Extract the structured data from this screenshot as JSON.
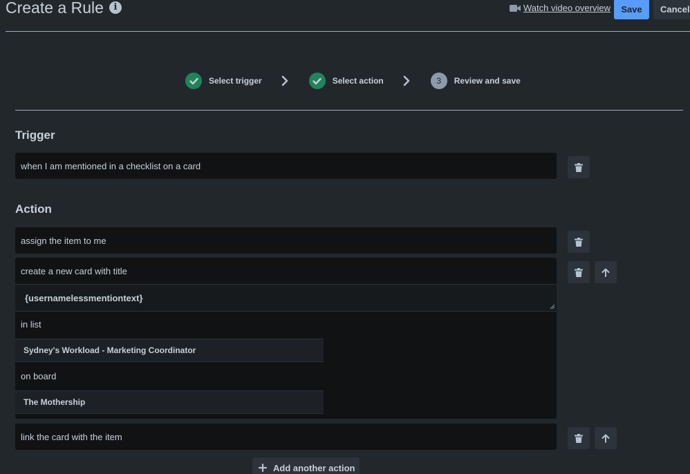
{
  "header": {
    "title": "Create a Rule",
    "watch_video": "Watch video overview",
    "save_label": "Save",
    "cancel_label": "Cancel"
  },
  "stepper": {
    "steps": [
      {
        "label": "Select trigger",
        "state": "done"
      },
      {
        "label": "Select action",
        "state": "done"
      },
      {
        "label": "Review and save",
        "state": "current",
        "number": "3"
      }
    ]
  },
  "trigger": {
    "heading": "Trigger",
    "text": "when I am mentioned in a checklist on a card"
  },
  "action": {
    "heading": "Action",
    "items": [
      {
        "text": "assign the item to me"
      },
      {
        "line1": "create a new card with title",
        "title_value": "{usernamelessmentiontext}",
        "line2": "in list",
        "list_value": "Sydney's Workload - Marketing Coordinator",
        "line3": "on board",
        "board_value": "The Mothership"
      },
      {
        "text": "link the card with the item"
      }
    ],
    "add_label": "Add another action"
  },
  "colors": {
    "background": "#22272b",
    "field": "#101214",
    "primary": "#579dff",
    "success": "#1f845a"
  }
}
